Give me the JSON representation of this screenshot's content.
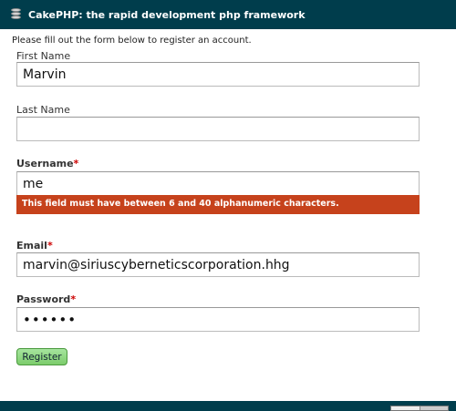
{
  "header": {
    "title": "CakePHP: the rapid development php framework",
    "logo_icon": "cake-stack-icon"
  },
  "intro_text": "Please fill out the form below to register an account.",
  "form": {
    "first_name": {
      "label": "First Name",
      "value": "Marvin"
    },
    "last_name": {
      "label": "Last Name",
      "value": ""
    },
    "username": {
      "label": "Username",
      "required_mark": "*",
      "value": "me",
      "error": "This field must have between 6 and 40 alphanumeric characters."
    },
    "email": {
      "label": "Email",
      "required_mark": "*",
      "value": "marvin@siriuscyberneticscorporation.hhg"
    },
    "password": {
      "label": "Password",
      "required_mark": "*",
      "value": "••••••"
    },
    "submit_label": "Register"
  },
  "colors": {
    "header_bg": "#003d4c",
    "error_bg": "#c6421c",
    "button_bg": "#7ccc6b"
  }
}
